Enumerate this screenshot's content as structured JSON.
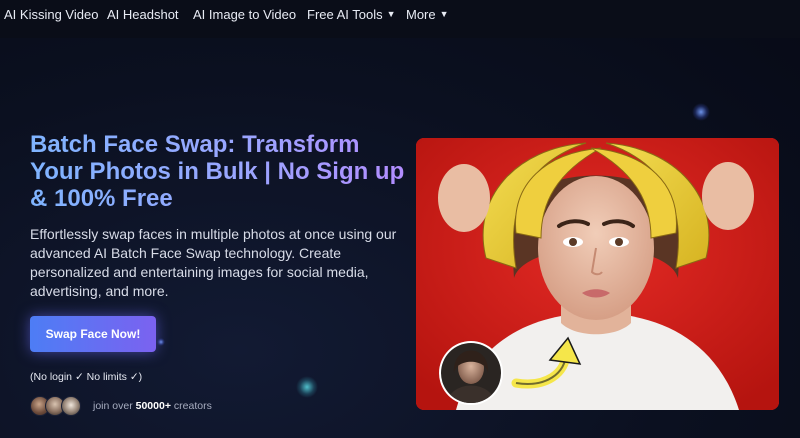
{
  "nav": {
    "items": [
      {
        "label": "AI Kissing Video",
        "dropdown": false
      },
      {
        "label": "AI Headshot",
        "dropdown": false
      },
      {
        "label": "AI Image to Video",
        "dropdown": false
      },
      {
        "label": "Free AI Tools",
        "dropdown": true
      },
      {
        "label": "More",
        "dropdown": true
      }
    ]
  },
  "hero": {
    "title": "Batch Face Swap: Transform Your Photos in Bulk | No Sign up & 100% Free",
    "description": "Effortlessly swap faces in multiple photos at once using our advanced AI Batch Face Swap technology. Create personalized and entertaining images for social media, advertising, and more.",
    "cta_label": "Swap Face Now!",
    "note": "(No login ✓ No limits ✓)",
    "social_proof": {
      "prefix": "join over",
      "count": "50000+",
      "suffix": "creators"
    }
  },
  "colors": {
    "background": "#0b1020",
    "title_gradient_start": "#7fb4ff",
    "title_gradient_end": "#b38cff",
    "cta_gradient_start": "#4d7df5",
    "cta_gradient_end": "#7b62f0",
    "photo_background": "#d8221f",
    "arrow_yellow": "#f5e64a"
  },
  "icons": {
    "dropdown": "chevron-down-icon",
    "arrow": "curved-arrow-icon"
  }
}
